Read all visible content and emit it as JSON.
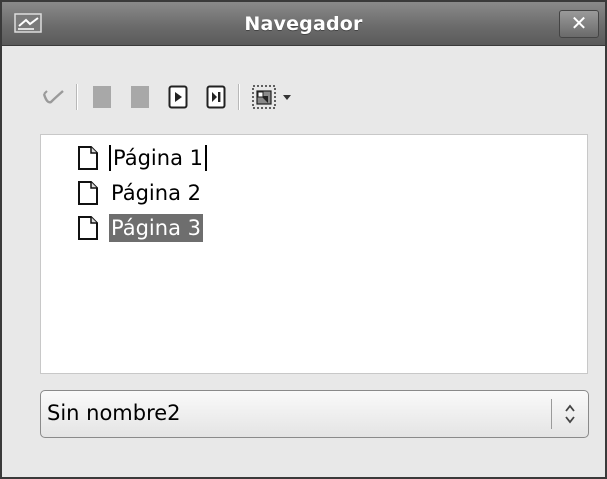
{
  "window": {
    "title": "Navegador",
    "close_label": "✕"
  },
  "toolbar": {
    "items": [
      {
        "name": "toggle-icon",
        "enabled": false
      },
      {
        "name": "first-page-icon",
        "enabled": false
      },
      {
        "name": "previous-page-icon",
        "enabled": false
      },
      {
        "name": "next-page-icon",
        "enabled": true
      },
      {
        "name": "last-page-icon",
        "enabled": true
      },
      {
        "name": "drag-mode-icon",
        "enabled": true
      },
      {
        "name": "dropdown-arrow-icon",
        "enabled": true
      }
    ]
  },
  "tree": {
    "items": [
      {
        "label": "Página 1",
        "selected": false,
        "editing": true
      },
      {
        "label": "Página 2",
        "selected": false,
        "editing": false
      },
      {
        "label": "Página 3",
        "selected": true,
        "editing": false
      }
    ]
  },
  "document_select": {
    "value": "Sin nombre2"
  },
  "colors": {
    "titlebar": "#6c6c6c",
    "selection": "#6e6e6e",
    "window_bg": "#e8e8e8"
  }
}
